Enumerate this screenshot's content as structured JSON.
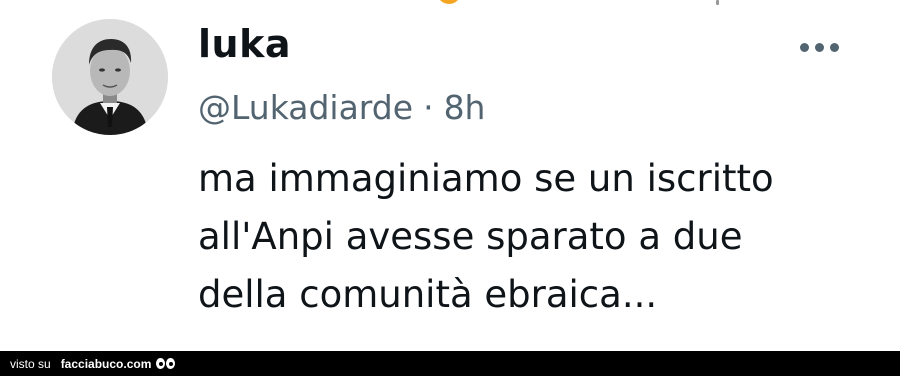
{
  "tweet": {
    "display_name": "luka",
    "handle": "@Lukadiarde",
    "separator": "·",
    "time": "8h",
    "text_lines": [
      "ma immaginiamo se un iscritto",
      "all'Anpi avesse sparato a due",
      "della comunità ebraica..."
    ],
    "avatar_icon": "profile-photo",
    "more_icon": "more-options-icon"
  },
  "footer": {
    "prefix": "visto su",
    "site": "facciabuco.com"
  },
  "colors": {
    "text": "#0f1419",
    "secondary": "#536471",
    "footer_bg": "#000000",
    "accent": "#f4a623"
  }
}
